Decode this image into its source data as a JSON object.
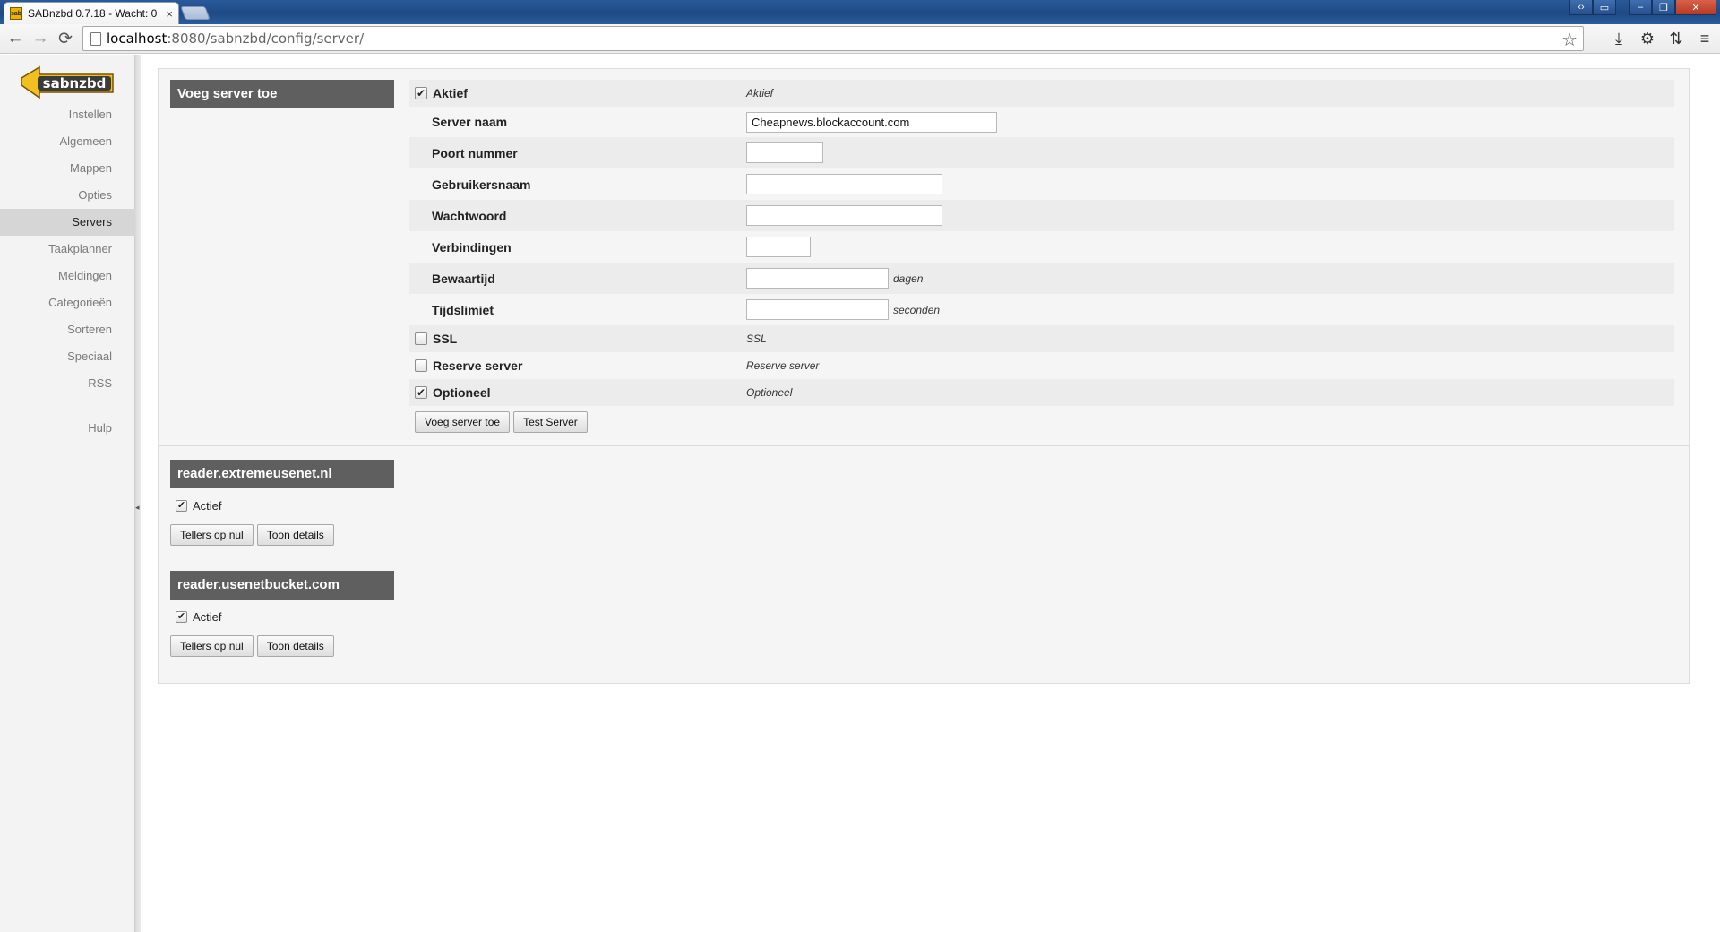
{
  "browser": {
    "tab_title": "SABnzbd 0.7.18 - Wacht: 0",
    "tab_favicon": "sab",
    "tab_close": "×",
    "url_host": "localhost",
    "url_path": ":8080/sabnzbd/config/server/",
    "icons": {
      "back": "←",
      "forward": "→",
      "reload": "⟳",
      "star": "☆",
      "download": "⤓",
      "settings": "⚙",
      "extension": "⇅",
      "menu": "≡"
    }
  },
  "sidebar": {
    "logo_text": "sabnzbd",
    "items": [
      {
        "label": "Instellen"
      },
      {
        "label": "Algemeen"
      },
      {
        "label": "Mappen"
      },
      {
        "label": "Opties"
      },
      {
        "label": "Servers"
      },
      {
        "label": "Taakplanner"
      },
      {
        "label": "Meldingen"
      },
      {
        "label": "Categorieën"
      },
      {
        "label": "Sorteren"
      },
      {
        "label": "Speciaal"
      },
      {
        "label": "RSS"
      }
    ],
    "active_item": "Servers",
    "help": "Hulp"
  },
  "add_server": {
    "header": "Voeg server toe",
    "rows": {
      "aktief": {
        "label": "Aktief",
        "checked": true,
        "desc": "Aktief"
      },
      "server_naam": {
        "label": "Server naam",
        "value": "Cheapnews.blockaccount.com"
      },
      "poort": {
        "label": "Poort nummer",
        "value": ""
      },
      "gebruikersnaam": {
        "label": "Gebruikersnaam",
        "value": ""
      },
      "wachtwoord": {
        "label": "Wachtwoord",
        "value": ""
      },
      "verbindingen": {
        "label": "Verbindingen",
        "value": ""
      },
      "bewaartijd": {
        "label": "Bewaartijd",
        "value": "",
        "unit": "dagen"
      },
      "tijdslimiet": {
        "label": "Tijdslimiet",
        "value": "",
        "unit": "seconden"
      },
      "ssl": {
        "label": "SSL",
        "checked": false,
        "desc": "SSL"
      },
      "reserve": {
        "label": "Reserve server",
        "checked": false,
        "desc": "Reserve server"
      },
      "optioneel": {
        "label": "Optioneel",
        "checked": true,
        "desc": "Optioneel"
      }
    },
    "add_button": "Voeg server toe",
    "test_button": "Test Server"
  },
  "servers": [
    {
      "name": "reader.extremeusenet.nl",
      "active_label": "Actief",
      "checked": true,
      "reset_button": "Tellers op nul",
      "details_button": "Toon details"
    },
    {
      "name": "reader.usenetbucket.com",
      "active_label": "Actief",
      "checked": true,
      "reset_button": "Tellers op nul",
      "details_button": "Toon details"
    }
  ],
  "glyphs": {
    "check": "✔",
    "collapse_arrow": "◂"
  }
}
